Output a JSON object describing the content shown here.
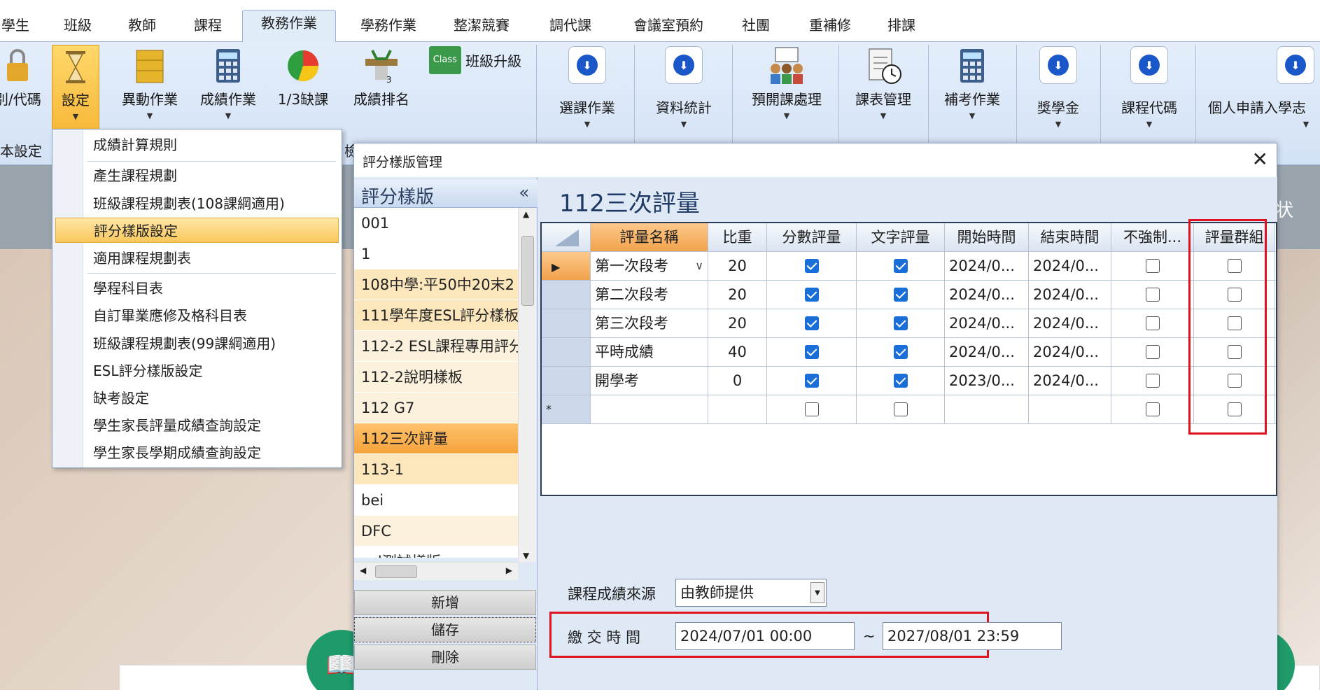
{
  "tabs": [
    "學生",
    "班級",
    "教師",
    "課程",
    "教務作業",
    "學務作業",
    "整潔競賽",
    "調代課",
    "會議室預約",
    "社團",
    "重補修",
    "排課"
  ],
  "active_tab": "教務作業",
  "ribbon": {
    "buttons": {
      "code": "別/代碼",
      "settings": "設定",
      "transfer": "異動作業",
      "grades": "成績作業",
      "absence": "1/3缺課",
      "ranking": "成績排名",
      "class_promote": "班級升級",
      "course_select": "選課作業",
      "data_stats": "資料統計",
      "pre_course": "預開課處理",
      "schedule_mgmt": "課表管理",
      "makeup_exam": "補考作業",
      "scholarship": "獎學金",
      "course_code": "課程代碼",
      "personal_apply": "個人申請入學志"
    },
    "group_label": "本設定",
    "badge_class": "Class",
    "badge_three": "3"
  },
  "menu": {
    "items": [
      "成績計算規則",
      "產生課程規劃",
      "班級課程規劃表(108課綱適用)",
      "評分樣版設定",
      "適用課程規劃表",
      "學程科目表",
      "自訂畢業應修及格科目表",
      "班級課程規劃表(99課綱適用)",
      "ESL評分樣版設定",
      "缺考設定",
      "學生家長評量成績查詢設定",
      "學生家長學期成績查詢設定"
    ],
    "highlighted": "評分樣版設定",
    "tail_char": "檢"
  },
  "dialog": {
    "title": "評分樣版管理",
    "close": "✕",
    "left_header": "評分樣版",
    "collapse": "«",
    "templates": [
      "001",
      "1",
      "108中學:平50中20末2",
      "111學年度ESL評分樣板",
      "112-2 ESL課程專用評分",
      "112-2說明樣板",
      "112 G7",
      "112三次評量",
      "113-1",
      "bei",
      "DFC",
      "esl測試樣版"
    ],
    "selected_template": "112三次評量",
    "buttons": {
      "add": "新增",
      "save": "儲存",
      "delete": "刪除"
    },
    "right_title": "112三次評量",
    "grid": {
      "headers": [
        "評量名稱",
        "比重",
        "分數評量",
        "文字評量",
        "開始時間",
        "結束時間",
        "不強制...",
        "評量群組"
      ],
      "rows": [
        {
          "name": "第一次段考",
          "weight": "20",
          "score": true,
          "text": true,
          "start": "2024/0...",
          "end": "2024/0...",
          "optional": false,
          "group": false
        },
        {
          "name": "第二次段考",
          "weight": "20",
          "score": true,
          "text": true,
          "start": "2024/0...",
          "end": "2024/0...",
          "optional": false,
          "group": false
        },
        {
          "name": "第三次段考",
          "weight": "20",
          "score": true,
          "text": true,
          "start": "2024/0...",
          "end": "2024/0...",
          "optional": false,
          "group": false
        },
        {
          "name": "平時成績",
          "weight": "40",
          "score": true,
          "text": true,
          "start": "2024/0...",
          "end": "2024/0...",
          "optional": false,
          "group": false
        },
        {
          "name": "開學考",
          "weight": "0",
          "score": true,
          "text": true,
          "start": "2023/0...",
          "end": "2024/0...",
          "optional": false,
          "group": false
        }
      ],
      "new_row_marker": "*"
    },
    "source_label": "課程成績來源",
    "source_value": "由教師提供",
    "submit_label": "繳 交 時 間",
    "submit_start": "2024/07/01 00:00",
    "tilde": "~",
    "submit_end": "2027/08/01 23:59"
  },
  "background": {
    "partial_text": "状"
  },
  "colors": {
    "accent_orange": "#f5a23a",
    "highlight_red": "#e0121f",
    "check_blue": "#1a6ed8",
    "ribbon_bg": "#d3e2f5",
    "icon_green": "#1f9a6a"
  }
}
